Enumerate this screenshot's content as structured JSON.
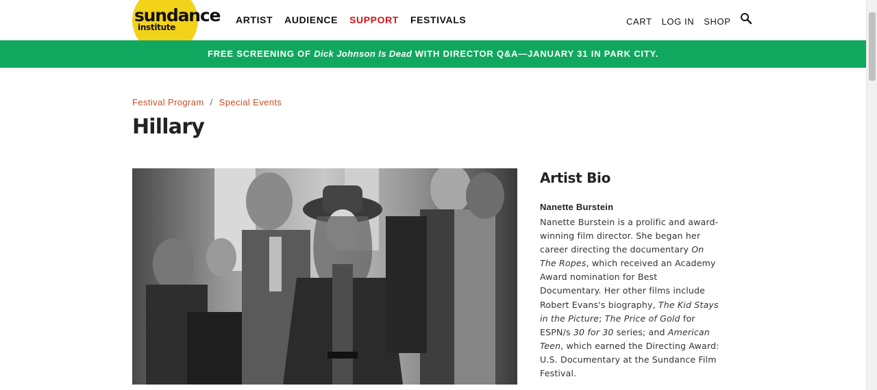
{
  "header": {
    "logo": {
      "word": "sundance",
      "sub": "institute"
    },
    "nav_left": [
      "ARTIST",
      "AUDIENCE",
      "SUPPORT",
      "FESTIVALS"
    ],
    "nav_right": [
      "CART",
      "LOG IN",
      "SHOP"
    ],
    "search_icon": "search-icon",
    "logo_color": "#f3d21a",
    "support_color": "#d4141b"
  },
  "banner": {
    "prefix": "FREE SCREENING OF ",
    "film": "Dick Johnson Is Dead",
    "suffix": " WITH DIRECTOR Q&A—JANUARY 31 IN PARK CITY.",
    "bg_color": "#10a85e"
  },
  "breadcrumb": [
    "Festival Program",
    "Special Events"
  ],
  "page_title": "Hillary",
  "bio": {
    "heading": "Artist Bio",
    "name": "Nanette Burstein",
    "t1": "Nanette Burstein is a prolific and award-winning film director. She began her career directing the documentary ",
    "i1": "On The Ropes",
    "t2": ", which received an Academy Award nomination for Best Documentary. Her other films include Robert Evans's biography, ",
    "i2": "The Kid Stays in the Picture",
    "t3": "; ",
    "i3": "The Price of Gold",
    "t4": " for ESPN/s ",
    "i4": "30 for 30",
    "t5": " series; and ",
    "i5": "American Teen",
    "t6": ", which earned the Directing Award: U.S. Documentary at the Sundance Film Festival."
  }
}
